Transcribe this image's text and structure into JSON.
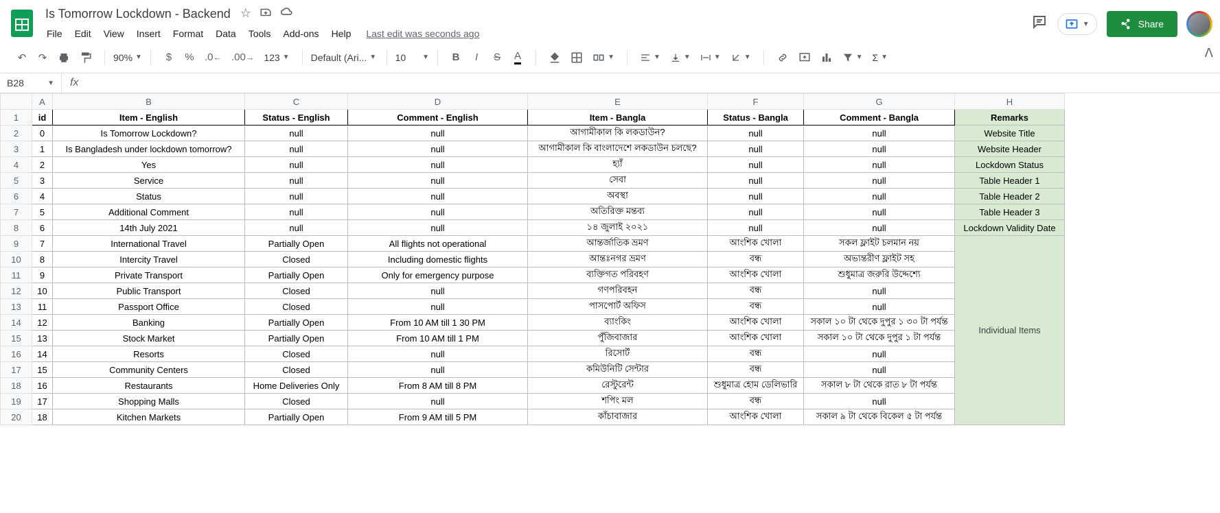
{
  "doc": {
    "title": "Is Tomorrow Lockdown - Backend",
    "last_edit": "Last edit was seconds ago"
  },
  "menus": [
    "File",
    "Edit",
    "View",
    "Insert",
    "Format",
    "Data",
    "Tools",
    "Add-ons",
    "Help"
  ],
  "toolbar": {
    "zoom": "90%",
    "font": "Default (Ari...",
    "font_size": "10",
    "number_format": "123"
  },
  "namebox": "B28",
  "share_label": "Share",
  "columns": [
    "A",
    "B",
    "C",
    "D",
    "E",
    "F",
    "G",
    "H"
  ],
  "headers": {
    "id": "id",
    "item_en": "Item - English",
    "status_en": "Status - English",
    "comment_en": "Comment - English",
    "item_bn": "Item - Bangla",
    "status_bn": "Status - Bangla",
    "comment_bn": "Comment - Bangla",
    "remarks": "Remarks"
  },
  "rows": [
    {
      "n": 2,
      "id": "0",
      "item_en": "Is Tomorrow Lockdown?",
      "status_en": "null",
      "comment_en": "null",
      "item_bn": "আগামীকাল কি লকডাউন?",
      "status_bn": "null",
      "comment_bn": "null",
      "remarks": "Website Title"
    },
    {
      "n": 3,
      "id": "1",
      "item_en": "Is Bangladesh under lockdown tomorrow?",
      "status_en": "null",
      "comment_en": "null",
      "item_bn": "আগামীকাল কি বাংলাদেশে লকডাউন চলছে?",
      "status_bn": "null",
      "comment_bn": "null",
      "remarks": "Website Header"
    },
    {
      "n": 4,
      "id": "2",
      "item_en": "Yes",
      "status_en": "null",
      "comment_en": "null",
      "item_bn": "হ্যাঁ",
      "status_bn": "null",
      "comment_bn": "null",
      "remarks": "Lockdown Status"
    },
    {
      "n": 5,
      "id": "3",
      "item_en": "Service",
      "status_en": "null",
      "comment_en": "null",
      "item_bn": "সেবা",
      "status_bn": "null",
      "comment_bn": "null",
      "remarks": "Table Header 1"
    },
    {
      "n": 6,
      "id": "4",
      "item_en": "Status",
      "status_en": "null",
      "comment_en": "null",
      "item_bn": "অবস্থা",
      "status_bn": "null",
      "comment_bn": "null",
      "remarks": "Table Header 2"
    },
    {
      "n": 7,
      "id": "5",
      "item_en": "Additional Comment",
      "status_en": "null",
      "comment_en": "null",
      "item_bn": "অতিরিক্ত মন্তব্য",
      "status_bn": "null",
      "comment_bn": "null",
      "remarks": "Table Header 3"
    },
    {
      "n": 8,
      "id": "6",
      "item_en": "14th July 2021",
      "status_en": "null",
      "comment_en": "null",
      "item_bn": "১৪ জুলাই ২০২১",
      "status_bn": "null",
      "comment_bn": "null",
      "remarks": "Lockdown Validity Date"
    },
    {
      "n": 9,
      "id": "7",
      "item_en": "International Travel",
      "status_en": "Partially Open",
      "comment_en": "All flights not operational",
      "item_bn": "আন্তর্জাতিক ভ্রমণ",
      "status_bn": "আংশিক খোলা",
      "comment_bn": "সকল ফ্লাইট চলমান নয়",
      "remarks": ""
    },
    {
      "n": 10,
      "id": "8",
      "item_en": "Intercity Travel",
      "status_en": "Closed",
      "comment_en": "Including domestic flights",
      "item_bn": "আন্তঃনগর ভ্রমণ",
      "status_bn": "বন্ধ",
      "comment_bn": "অভ্যন্তরীণ ফ্লাইট সহ",
      "remarks": ""
    },
    {
      "n": 11,
      "id": "9",
      "item_en": "Private Transport",
      "status_en": "Partially Open",
      "comment_en": "Only for emergency purpose",
      "item_bn": "ব্যক্তিগত পরিবহণ",
      "status_bn": "আংশিক খোলা",
      "comment_bn": "শুধুমাত্র জরুরি উদ্দেশ্যে",
      "remarks": ""
    },
    {
      "n": 12,
      "id": "10",
      "item_en": "Public Transport",
      "status_en": "Closed",
      "comment_en": "null",
      "item_bn": "গণপরিবহন",
      "status_bn": "বন্ধ",
      "comment_bn": "null",
      "remarks": ""
    },
    {
      "n": 13,
      "id": "11",
      "item_en": "Passport Office",
      "status_en": "Closed",
      "comment_en": "null",
      "item_bn": "পাসপোর্ট অফিস",
      "status_bn": "বন্ধ",
      "comment_bn": "null",
      "remarks": ""
    },
    {
      "n": 14,
      "id": "12",
      "item_en": "Banking",
      "status_en": "Partially Open",
      "comment_en": "From 10 AM till 1 30 PM",
      "item_bn": "ব্যাংকিং",
      "status_bn": "আংশিক খোলা",
      "comment_bn": "সকাল ১০ টা থেকে দুপুর ১ ৩০ টা পর্যন্ত",
      "remarks": ""
    },
    {
      "n": 15,
      "id": "13",
      "item_en": "Stock Market",
      "status_en": "Partially Open",
      "comment_en": "From 10 AM till 1 PM",
      "item_bn": "পুঁজিবাজার",
      "status_bn": "আংশিক খোলা",
      "comment_bn": "সকাল ১০ টা থেকে দুপুর ১ টা পর্যন্ত",
      "remarks": ""
    },
    {
      "n": 16,
      "id": "14",
      "item_en": "Resorts",
      "status_en": "Closed",
      "comment_en": "null",
      "item_bn": "রিসোর্ট",
      "status_bn": "বন্ধ",
      "comment_bn": "null",
      "remarks": ""
    },
    {
      "n": 17,
      "id": "15",
      "item_en": "Community Centers",
      "status_en": "Closed",
      "comment_en": "null",
      "item_bn": "কমিউনিটি সেন্টার",
      "status_bn": "বন্ধ",
      "comment_bn": "null",
      "remarks": ""
    },
    {
      "n": 18,
      "id": "16",
      "item_en": "Restaurants",
      "status_en": "Home Deliveries Only",
      "comment_en": "From 8 AM till 8 PM",
      "item_bn": "রেস্টুরেন্ট",
      "status_bn": "শুধুমাত্র হোম ডেলিভারি",
      "comment_bn": "সকাল ৮ টা থেকে রাত ৮ টা পর্যন্ত",
      "remarks": ""
    },
    {
      "n": 19,
      "id": "17",
      "item_en": "Shopping Malls",
      "status_en": "Closed",
      "comment_en": "null",
      "item_bn": "শপিং মল",
      "status_bn": "বন্ধ",
      "comment_bn": "null",
      "remarks": ""
    },
    {
      "n": 20,
      "id": "18",
      "item_en": "Kitchen Markets",
      "status_en": "Partially Open",
      "comment_en": "From 9 AM till 5 PM",
      "item_bn": "কাঁচাবাজার",
      "status_bn": "আংশিক খোলা",
      "comment_bn": "সকাল ৯ টা থেকে বিকেল ৫ টা পর্যন্ত",
      "remarks": ""
    }
  ],
  "merged_remark_label": "Individual Items"
}
